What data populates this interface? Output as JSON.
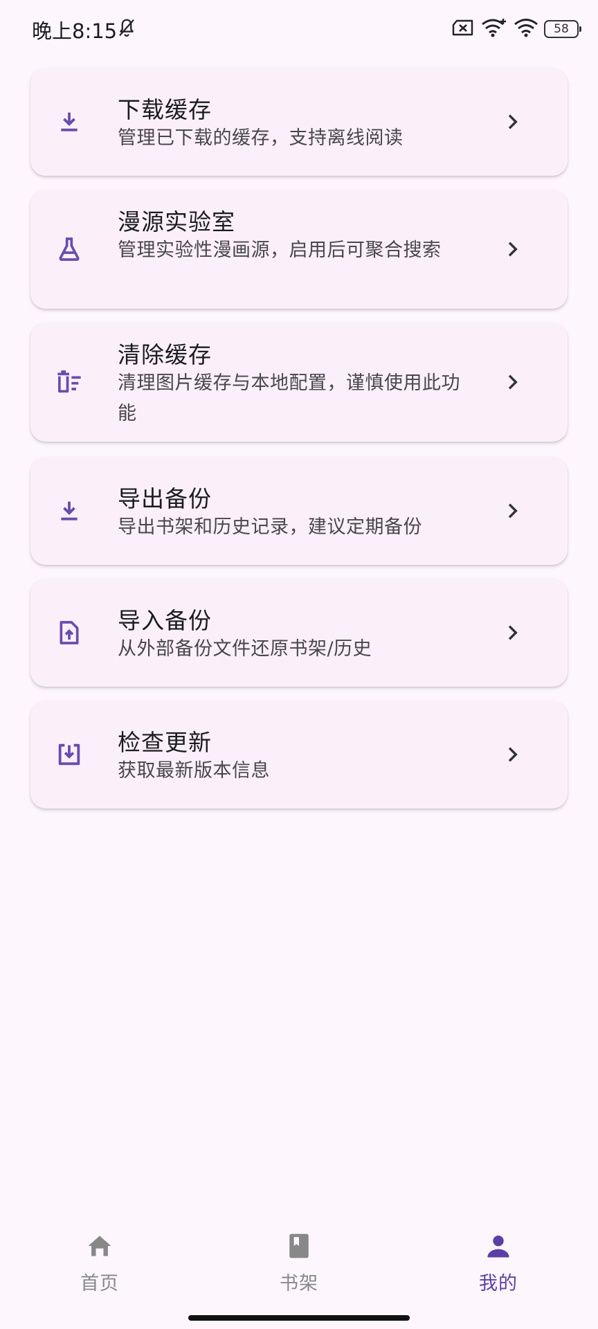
{
  "status_bar": {
    "time": "晚上8:15",
    "battery": "58"
  },
  "colors": {
    "accent": "#6a4cad",
    "background": "#fdf6fd",
    "card": "#fbf0fa"
  },
  "menu": [
    {
      "icon": "download-icon",
      "title": "下载缓存",
      "desc": "管理已下载的缓存，支持离线阅读"
    },
    {
      "icon": "flask-icon",
      "title": "漫源实验室",
      "desc": "管理实验性漫画源，启用后可聚合搜索"
    },
    {
      "icon": "delete-sweep-icon",
      "title": "清除缓存",
      "desc": "清理图片缓存与本地配置，谨慎使用此功能"
    },
    {
      "icon": "download-icon",
      "title": "导出备份",
      "desc": "导出书架和历史记录，建议定期备份"
    },
    {
      "icon": "file-upload-icon",
      "title": "导入备份",
      "desc": "从外部备份文件还原书架/历史"
    },
    {
      "icon": "system-update-icon",
      "title": "检查更新",
      "desc": "获取最新版本信息"
    }
  ],
  "nav": [
    {
      "icon": "home-icon",
      "label": "首页",
      "active": false
    },
    {
      "icon": "book-icon",
      "label": "书架",
      "active": false
    },
    {
      "icon": "person-icon",
      "label": "我的",
      "active": true
    }
  ]
}
